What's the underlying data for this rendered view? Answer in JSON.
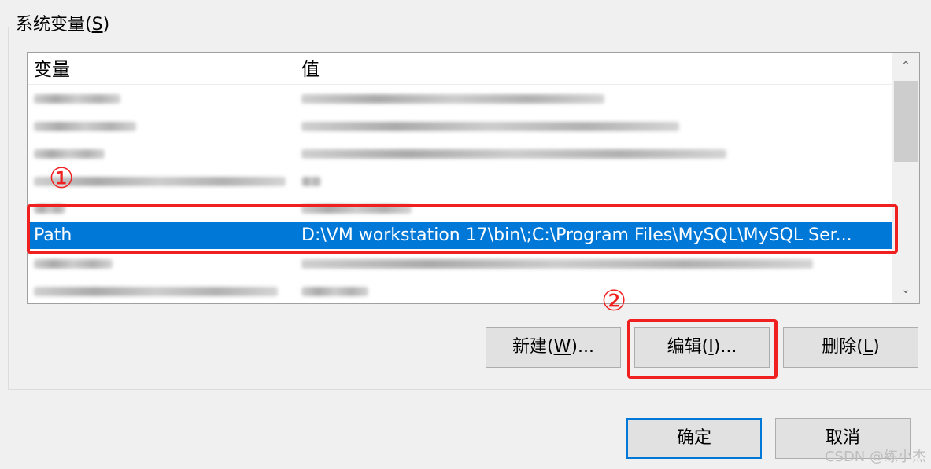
{
  "system_vars": {
    "group_label": "系统变量(",
    "group_accel": "S",
    "group_close": ")",
    "columns": {
      "name": "变量",
      "value": "值"
    },
    "rows": [
      {
        "name": "",
        "value": "",
        "blurred": true
      },
      {
        "name": "",
        "value": "",
        "blurred": true
      },
      {
        "name": "",
        "value": "",
        "blurred": true
      },
      {
        "name": "",
        "value": "",
        "blurred": true
      },
      {
        "name": "",
        "value": "",
        "blurred": true
      },
      {
        "name": "Path",
        "value": "D:\\VM workstation 17\\bin\\;C:\\Program Files\\MySQL\\MySQL Ser...",
        "selected": true
      },
      {
        "name": "",
        "value": "",
        "blurred": true
      },
      {
        "name": "",
        "value": "",
        "blurred": true
      }
    ],
    "buttons": {
      "new_pre": "新建(",
      "new_accel": "W",
      "new_post": ")...",
      "edit_pre": "编辑(",
      "edit_accel": "I",
      "edit_post": ")...",
      "delete_pre": "删除(",
      "delete_accel": "L",
      "delete_post": ")"
    }
  },
  "dialog": {
    "ok_label": "确定",
    "cancel_label": "取消"
  },
  "annotations": {
    "marker_1": "①",
    "marker_2": "②"
  },
  "watermark": "CSDN @练小杰",
  "colors": {
    "selection": "#0078d7",
    "annotation": "#f02020"
  },
  "icons": {
    "scroll_up": "chevron-up-icon",
    "scroll_down": "chevron-down-icon"
  }
}
